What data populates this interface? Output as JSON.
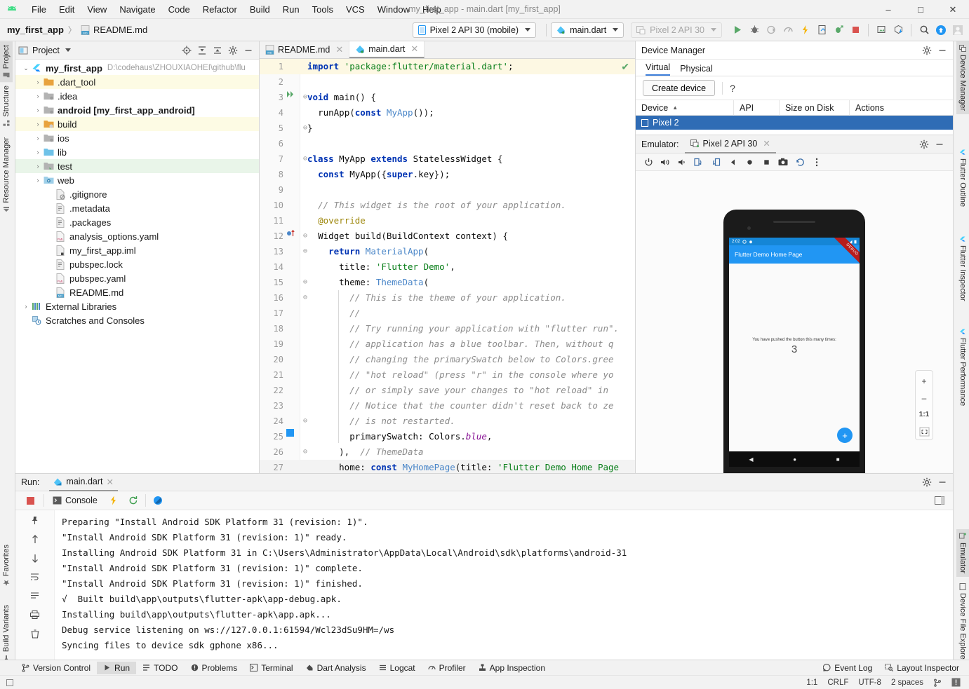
{
  "window": {
    "title": "my_first_app - main.dart [my_first_app]",
    "minimize": "–",
    "maximize": "□",
    "close": "✕"
  },
  "menu": {
    "items": [
      "File",
      "Edit",
      "View",
      "Navigate",
      "Code",
      "Refactor",
      "Build",
      "Run",
      "Tools",
      "VCS",
      "Window",
      "Help"
    ]
  },
  "breadcrumb": {
    "project": "my_first_app",
    "separator": "〉",
    "file": "README.md"
  },
  "toolbar": {
    "device_combo": "Pixel 2 API 30 (mobile)",
    "config_combo": "main.dart",
    "ghost_combo": "Pixel 2 API 30",
    "icons": [
      "run-icon",
      "debug-icon",
      "profile-icon",
      "performance-icon",
      "hot-reload-icon",
      "device-screenshot-icon",
      "attach-debugger-icon",
      "stop-icon",
      "device-manager-icon",
      "sdk-manager-icon",
      "search-icon",
      "update-icon",
      "account-icon"
    ]
  },
  "left_strip": {
    "tabs": [
      "Project",
      "Structure",
      "Resource Manager",
      "Favorites",
      "Build Variants"
    ]
  },
  "right_strip": {
    "tabs": [
      "Device Manager",
      "Flutter Outline",
      "Flutter Inspector",
      "Flutter Performance",
      "Emulator",
      "Device File Explorer"
    ]
  },
  "project_panel": {
    "title": "Project",
    "header_icons": [
      "locate-icon",
      "expand-all-icon",
      "collapse-all-icon",
      "gear-icon",
      "minimize-icon"
    ],
    "tree": [
      {
        "label": "my_first_app",
        "path": "D:\\codehaus\\ZHOUXIAOHEI\\github\\flu",
        "indent": 0,
        "arrow": "⌄",
        "icon": "flutter-icon",
        "bold": true,
        "highlight": ""
      },
      {
        "label": ".dart_tool",
        "path": "",
        "indent": 1,
        "arrow": "›",
        "icon": "folder-orange-icon",
        "bold": false,
        "highlight": "y"
      },
      {
        "label": ".idea",
        "path": "",
        "indent": 1,
        "arrow": "›",
        "icon": "folder-module-icon",
        "bold": false,
        "highlight": ""
      },
      {
        "label": "android [my_first_app_android]",
        "path": "",
        "indent": 1,
        "arrow": "›",
        "icon": "folder-module-icon",
        "bold": true,
        "highlight": ""
      },
      {
        "label": "build",
        "path": "",
        "indent": 1,
        "arrow": "›",
        "icon": "folder-excluded-icon",
        "bold": false,
        "highlight": "y"
      },
      {
        "label": "ios",
        "path": "",
        "indent": 1,
        "arrow": "›",
        "icon": "folder-module-icon",
        "bold": false,
        "highlight": ""
      },
      {
        "label": "lib",
        "path": "",
        "indent": 1,
        "arrow": "›",
        "icon": "folder-source-icon",
        "bold": false,
        "highlight": ""
      },
      {
        "label": "test",
        "path": "",
        "indent": 1,
        "arrow": "›",
        "icon": "folder-test-icon",
        "bold": false,
        "highlight": "g"
      },
      {
        "label": "web",
        "path": "",
        "indent": 1,
        "arrow": "›",
        "icon": "folder-web-icon",
        "bold": false,
        "highlight": ""
      },
      {
        "label": ".gitignore",
        "path": "",
        "indent": 2,
        "arrow": "",
        "icon": "gitignore-file-icon",
        "bold": false,
        "highlight": ""
      },
      {
        "label": ".metadata",
        "path": "",
        "indent": 2,
        "arrow": "",
        "icon": "text-file-icon",
        "bold": false,
        "highlight": ""
      },
      {
        "label": ".packages",
        "path": "",
        "indent": 2,
        "arrow": "",
        "icon": "text-file-icon",
        "bold": false,
        "highlight": ""
      },
      {
        "label": "analysis_options.yaml",
        "path": "",
        "indent": 2,
        "arrow": "",
        "icon": "yaml-file-icon",
        "bold": false,
        "highlight": ""
      },
      {
        "label": "my_first_app.iml",
        "path": "",
        "indent": 2,
        "arrow": "",
        "icon": "iml-file-icon",
        "bold": false,
        "highlight": ""
      },
      {
        "label": "pubspec.lock",
        "path": "",
        "indent": 2,
        "arrow": "",
        "icon": "text-file-icon",
        "bold": false,
        "highlight": ""
      },
      {
        "label": "pubspec.yaml",
        "path": "",
        "indent": 2,
        "arrow": "",
        "icon": "yaml-file-icon",
        "bold": false,
        "highlight": ""
      },
      {
        "label": "README.md",
        "path": "",
        "indent": 2,
        "arrow": "",
        "icon": "markdown-file-icon",
        "bold": false,
        "highlight": ""
      },
      {
        "label": "External Libraries",
        "path": "",
        "indent": 0,
        "arrow": "›",
        "icon": "libraries-icon",
        "bold": false,
        "highlight": ""
      },
      {
        "label": "Scratches and Consoles",
        "path": "",
        "indent": 0,
        "arrow": "",
        "icon": "scratches-icon",
        "bold": false,
        "highlight": ""
      }
    ]
  },
  "editor": {
    "tabs": [
      {
        "label": "README.md",
        "icon": "markdown-file-icon",
        "active": false
      },
      {
        "label": "main.dart",
        "icon": "dart-file-icon",
        "active": true
      }
    ],
    "inspection_ok": "✔",
    "lines": [
      {
        "n": "1",
        "hl": true,
        "fold": "",
        "gmark": "",
        "html": "<span class='kw'>import</span> <span class='str'>'package:flutter/material.dart'</span>;"
      },
      {
        "n": "2",
        "hl": false,
        "fold": "",
        "gmark": "",
        "html": ""
      },
      {
        "n": "3",
        "hl": false,
        "fold": "⊖",
        "gmark": "run-gutter-icon",
        "html": "<span class='kw'>void</span> <span class='pln'>main</span>() {"
      },
      {
        "n": "4",
        "hl": false,
        "fold": "",
        "gmark": "",
        "html": "  <span class='pln'>runApp</span>(<span class='kw'>const</span> <span class='typ'>MyApp</span>());"
      },
      {
        "n": "5",
        "hl": false,
        "fold": "⊖",
        "gmark": "",
        "html": "}"
      },
      {
        "n": "6",
        "hl": false,
        "fold": "",
        "gmark": "",
        "html": ""
      },
      {
        "n": "7",
        "hl": false,
        "fold": "⊖",
        "gmark": "",
        "html": "<span class='kw'>class</span> <span class='pln'>MyApp</span> <span class='kw'>extends</span> <span class='pln'>StatelessWidget</span> {"
      },
      {
        "n": "8",
        "hl": false,
        "fold": "",
        "gmark": "",
        "html": "  <span class='kw'>const</span> <span class='pln'>MyApp</span>({<span class='kw'>super</span>.<span class='pln'>key</span>});"
      },
      {
        "n": "9",
        "hl": false,
        "fold": "",
        "gmark": "",
        "html": ""
      },
      {
        "n": "10",
        "hl": false,
        "fold": "",
        "gmark": "",
        "html": "  <span class='cmt'>// This widget is the root of your application.</span>"
      },
      {
        "n": "11",
        "hl": false,
        "fold": "",
        "gmark": "",
        "html": "  <span class='ann'>@override</span>"
      },
      {
        "n": "12",
        "hl": false,
        "fold": "⊖",
        "gmark": "override-gutter-icon",
        "html": "  <span class='pln'>Widget build</span>(<span class='pln'>BuildContext context</span>) {"
      },
      {
        "n": "13",
        "hl": false,
        "fold": "⊖",
        "gmark": "",
        "html": "    <span class='kw'>return</span> <span class='typ'>MaterialApp</span>("
      },
      {
        "n": "14",
        "hl": false,
        "fold": "",
        "gmark": "",
        "html": "      <span class='pln'>title:</span> <span class='str'>'Flutter Demo'</span>,"
      },
      {
        "n": "15",
        "hl": false,
        "fold": "⊖",
        "gmark": "",
        "html": "      <span class='pln'>theme:</span> <span class='typ'>ThemeData</span>("
      },
      {
        "n": "16",
        "hl": false,
        "fold": "⊖",
        "gmark": "",
        "html": "        <span class='cmt'>// This is the theme of your application.</span>"
      },
      {
        "n": "17",
        "hl": false,
        "fold": "",
        "gmark": "",
        "html": "        <span class='cmt'>//</span>"
      },
      {
        "n": "18",
        "hl": false,
        "fold": "",
        "gmark": "",
        "html": "        <span class='cmt'>// Try running your application with \"flutter run\".</span>"
      },
      {
        "n": "19",
        "hl": false,
        "fold": "",
        "gmark": "",
        "html": "        <span class='cmt'>// application has a blue toolbar. Then, without q</span>"
      },
      {
        "n": "20",
        "hl": false,
        "fold": "",
        "gmark": "",
        "html": "        <span class='cmt'>// changing the primarySwatch below to Colors.gree</span>"
      },
      {
        "n": "21",
        "hl": false,
        "fold": "",
        "gmark": "",
        "html": "        <span class='cmt'>// \"hot reload\" (press \"r\" in the console where yo</span>"
      },
      {
        "n": "22",
        "hl": false,
        "fold": "",
        "gmark": "",
        "html": "        <span class='cmt'>// or simply save your changes to \"hot reload\" in </span>"
      },
      {
        "n": "23",
        "hl": false,
        "fold": "",
        "gmark": "",
        "html": "        <span class='cmt'>// Notice that the counter didn't reset back to ze</span>"
      },
      {
        "n": "24",
        "hl": false,
        "fold": "⊖",
        "gmark": "",
        "html": "        <span class='cmt'>// is not restarted.</span>"
      },
      {
        "n": "25",
        "hl": false,
        "fold": "",
        "gmark": "color-swatch-icon",
        "html": "        <span class='pln'>primarySwatch:</span> <span class='pln'>Colors</span>.<span class='fld'>blue</span>,"
      },
      {
        "n": "26",
        "hl": false,
        "fold": "⊖",
        "gmark": "",
        "html": "      ),  <span class='cmt'>// ThemeData</span>"
      },
      {
        "n": "27",
        "hl": false,
        "fold": "",
        "gmark": "",
        "html": "      <span class='pln'>home:</span> <span class='kw'>const</span> <span class='typ'>MyHomePage</span>(<span class='pln'>title:</span> <span class='str'>'Flutter Demo Home Page</span>"
      }
    ]
  },
  "device_manager": {
    "title": "Device Manager",
    "gear": "gear-icon",
    "minimize": "–",
    "tabs": [
      {
        "label": "Virtual",
        "selected": true
      },
      {
        "label": "Physical",
        "selected": false
      }
    ],
    "create_button": "Create device",
    "help": "?",
    "columns": [
      "Device",
      "API",
      "Size on Disk",
      "Actions"
    ],
    "sort_arrow": "▲",
    "rows": [
      {
        "device": "Pixel 2",
        "api": "",
        "size": "",
        "actions": ""
      }
    ]
  },
  "emulator": {
    "label": "Emulator:",
    "tab_label": "Pixel 2 API 30",
    "close": "✕",
    "gear": "gear-icon",
    "minimize": "–",
    "toolbar_icons": [
      "power-icon",
      "volume-up-icon",
      "volume-down-icon",
      "rotate-left-icon",
      "rotate-right-icon",
      "back-icon",
      "home-icon",
      "overview-icon",
      "screenshot-icon",
      "history-icon",
      "more-icon"
    ],
    "zoom_controls": {
      "zoom_in": "+",
      "zoom_out": "–",
      "actual_size": "1:1",
      "fit": "fit-screen-icon"
    },
    "screen": {
      "status_time": "2:02",
      "status_icons": [
        "settings-icon",
        "bug-icon",
        "wifi-icon",
        "battery-icon"
      ],
      "appbar_title": "Flutter Demo Home Page",
      "debug_banner": "DEBUG",
      "counter_label": "You have pushed the button this many times:",
      "counter_value": "3",
      "fab_label": "+",
      "nav_back": "◀",
      "nav_home": "●",
      "nav_recents": "■"
    }
  },
  "run_panel": {
    "label": "Run:",
    "tab_label": "main.dart",
    "tab_close": "✕",
    "gear": "gear-icon",
    "minimize": "–",
    "stop_icon": "stop-icon",
    "console_label": "Console",
    "console_icons": [
      "console-icon",
      "hot-reload-icon",
      "restart-icon",
      "dart-devtools-icon"
    ],
    "gutter_icons": [
      "pin-icon",
      "scroll-up-icon",
      "scroll-down-icon",
      "soft-wrap-icon",
      "scroll-end-icon",
      "print-icon",
      "clear-icon"
    ],
    "output": [
      "Preparing \"Install Android SDK Platform 31 (revision: 1)\".",
      "\"Install Android SDK Platform 31 (revision: 1)\" ready.",
      "Installing Android SDK Platform 31 in C:\\Users\\Administrator\\AppData\\Local\\Android\\sdk\\platforms\\android-31",
      "\"Install Android SDK Platform 31 (revision: 1)\" complete.",
      "\"Install Android SDK Platform 31 (revision: 1)\" finished.",
      "√  Built build\\app\\outputs\\flutter-apk\\app-debug.apk.",
      "Installing build\\app\\outputs\\flutter-apk\\app.apk...",
      "Debug service listening on ws://127.0.0.1:61594/Wcl23dSu9HM=/ws",
      "Syncing files to device sdk gphone x86..."
    ]
  },
  "status_bar": {
    "left_items": [
      {
        "label": "Version Control",
        "icon": "branch-icon",
        "selected": false
      },
      {
        "label": "Run",
        "icon": "run-icon",
        "selected": true
      },
      {
        "label": "TODO",
        "icon": "todo-icon",
        "selected": false
      },
      {
        "label": "Problems",
        "icon": "problems-icon",
        "selected": false
      },
      {
        "label": "Terminal",
        "icon": "terminal-icon",
        "selected": false
      },
      {
        "label": "Dart Analysis",
        "icon": "dart-icon",
        "selected": false
      },
      {
        "label": "Logcat",
        "icon": "logcat-icon",
        "selected": false
      },
      {
        "label": "Profiler",
        "icon": "profiler-icon",
        "selected": false
      },
      {
        "label": "App Inspection",
        "icon": "inspection-icon",
        "selected": false
      }
    ],
    "right_items": [
      {
        "label": "Event Log",
        "icon": "event-log-icon"
      },
      {
        "label": "Layout Inspector",
        "icon": "layout-inspector-icon"
      }
    ]
  },
  "status_bar_2": {
    "caret": "1:1",
    "line_sep": "CRLF",
    "encoding": "UTF-8",
    "indent": "2 spaces",
    "branch_icon": "branch-icon",
    "notify_icon": "notification-icon"
  },
  "colors": {
    "accent": "#2196f3",
    "selection": "#2f6cb5",
    "debug_banner": "#b71c1c",
    "panel_bg": "#f2f2f2"
  }
}
